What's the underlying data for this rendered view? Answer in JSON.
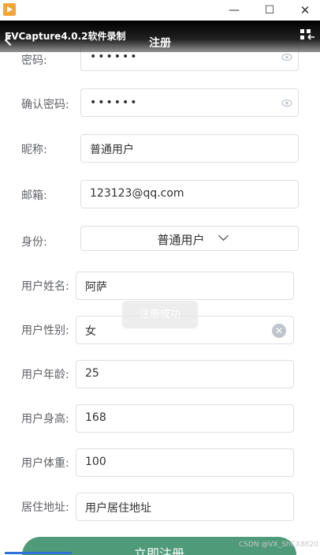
{
  "window": {
    "minimize": "—",
    "maximize": "☐",
    "close": "✕"
  },
  "header": {
    "watermark_text": "EVCapture4.0.2软件录制",
    "title": "注册"
  },
  "form": {
    "password": {
      "label": "密码:",
      "value": "••••••"
    },
    "confirm_password": {
      "label": "确认密码:",
      "value": "••••••"
    },
    "nickname": {
      "label": "昵称:",
      "value": "普通用户"
    },
    "email": {
      "label": "邮箱:",
      "value": "123123@qq.com"
    },
    "role": {
      "label": "身份:",
      "value": "普通用户"
    },
    "real_name": {
      "label": "用户姓名:",
      "value": "阿萨"
    },
    "gender": {
      "label": "用户性别:",
      "value": "女"
    },
    "age": {
      "label": "用户年龄:",
      "value": "25"
    },
    "height": {
      "label": "用户身高:",
      "value": "168"
    },
    "weight": {
      "label": "用户体重:",
      "value": "100"
    },
    "address": {
      "label": "居住地址:",
      "value": "用户居住地址"
    }
  },
  "toast": {
    "text": "注册成功"
  },
  "submit_button": {
    "label": "立即注册"
  },
  "footer_watermark": "CSDN @VX_ShCX8820",
  "colors": {
    "accent": "#4f9a78",
    "progress": "#2f73d8",
    "border": "#dcdfe6"
  },
  "icons": [
    "app-icon",
    "back-icon",
    "layout-toggle-icon",
    "eye-icon",
    "chevron-down-icon",
    "clear-icon"
  ]
}
